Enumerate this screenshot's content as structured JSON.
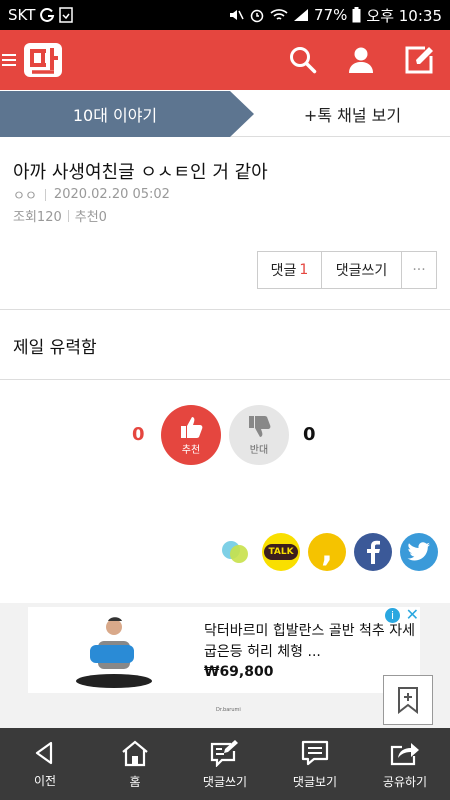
{
  "status_bar": {
    "carrier": "SKT",
    "battery": "77%",
    "time": "오후 10:35"
  },
  "tabs": {
    "active": "10대 이야기",
    "other": "+톡 채널 보기"
  },
  "post": {
    "title": "아까 사생여친글 ㅇㅅㅌ인 거 같아",
    "author": "ㅇㅇ",
    "date": "2020.02.20 05:02",
    "views": "조회120",
    "recommends": "추천0",
    "body": "제일 유력함"
  },
  "comment_bar": {
    "comments_label": "댓글",
    "comments_count": "1",
    "write_comment": "댓글쓰기",
    "more": "···"
  },
  "votes": {
    "up_count": "0",
    "up_label": "추천",
    "down_count": "0",
    "down_label": "반대"
  },
  "share": {
    "kakao_talk_label": "TALK",
    "kakao_story_label": ","
  },
  "ad": {
    "title": "닥터바르미 힙발란스 골반 척추 자세 굽은등 허리 체형 ...",
    "price": "₩69,800",
    "info_label": "i",
    "close_label": "✕",
    "brand_small": "Dr.barumi"
  },
  "bottom_nav": {
    "items": [
      {
        "label": "이전",
        "icon": "back-icon"
      },
      {
        "label": "홈",
        "icon": "home-icon"
      },
      {
        "label": "댓글쓰기",
        "icon": "write-comment-icon"
      },
      {
        "label": "댓글보기",
        "icon": "view-comments-icon"
      },
      {
        "label": "공유하기",
        "icon": "share-icon"
      }
    ]
  },
  "colors": {
    "brand_red": "#e5463f",
    "tab_blue": "#5d7590",
    "bottom_nav": "#3a3a3a"
  }
}
